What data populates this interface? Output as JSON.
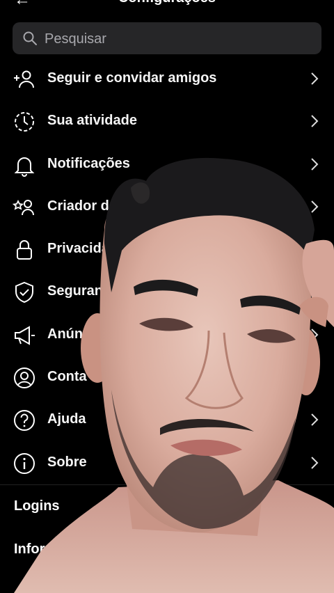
{
  "header": {
    "title": "Configurações",
    "back_icon": "back-arrow-icon"
  },
  "search": {
    "placeholder": "Pesquisar"
  },
  "menu": [
    {
      "label": "Seguir e convidar amigos",
      "icon": "add-person-icon"
    },
    {
      "label": "Sua atividade",
      "icon": "activity-clock-icon"
    },
    {
      "label": "Notificações",
      "icon": "bell-icon"
    },
    {
      "label": "Criador de c",
      "icon": "creator-star-icon"
    },
    {
      "label": "Privacidad",
      "icon": "lock-icon"
    },
    {
      "label": "Seguranc",
      "icon": "shield-check-icon"
    },
    {
      "label": "Anún",
      "icon": "megaphone-icon"
    },
    {
      "label": "Conta",
      "icon": "account-circle-icon"
    },
    {
      "label": "Ajuda",
      "icon": "help-icon"
    },
    {
      "label": "Sobre",
      "icon": "info-icon"
    }
  ],
  "logins": {
    "section_title": "Logins",
    "info_label": "Informaç"
  },
  "colors": {
    "background": "#000000",
    "search_bg": "#262628",
    "text": "#f5f5f5"
  }
}
